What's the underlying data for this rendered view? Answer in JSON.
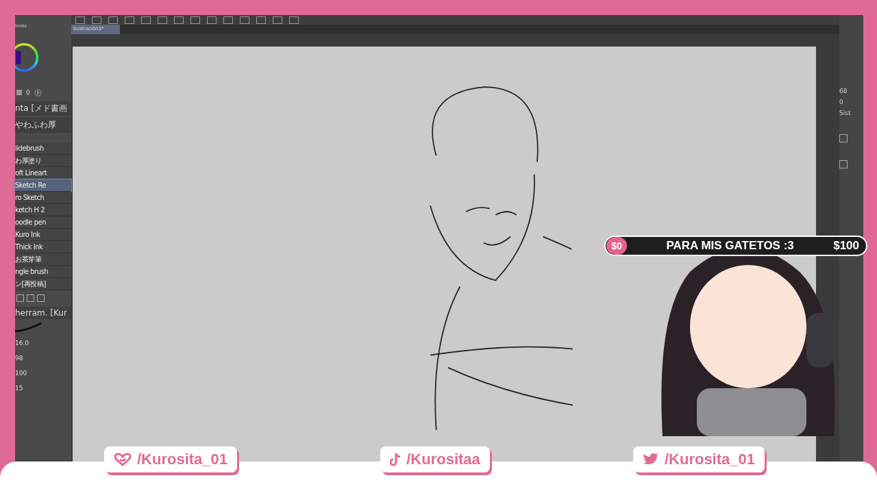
{
  "left_panel": {
    "header": "lores",
    "color_value": "0",
    "brush_set_label": "nta [メド書画",
    "brush_set_name": "やわふわ厚",
    "brushes": [
      {
        "name": "iidebrush",
        "selected": false
      },
      {
        "name": "わ厚塗り",
        "selected": false
      },
      {
        "name": "oft Lineart",
        "selected": false
      },
      {
        "name": "Sketch Re",
        "selected": true
      },
      {
        "name": "ro Sketch",
        "selected": false
      },
      {
        "name": "ketch H 2",
        "selected": false
      },
      {
        "name": "oodle pen",
        "selected": false
      },
      {
        "name": "Kuro Ink",
        "selected": false
      },
      {
        "name": "Thick Ink",
        "selected": false
      },
      {
        "name": "お茶芽筆",
        "selected": false
      },
      {
        "name": "ngle brush",
        "selected": false
      },
      {
        "name": "ン[再投稿]",
        "selected": false
      }
    ],
    "tool_property_label": "herram. [Kur",
    "values": [
      "16.0",
      "98",
      "100",
      "15"
    ]
  },
  "document_tab": {
    "title": "Ilustración3*"
  },
  "right_panel": {
    "values": [
      "68",
      "0"
    ],
    "label": "Sist"
  },
  "goal_bar": {
    "current": "$0",
    "title": "PARA MIS GATETOS :3",
    "target": "$100"
  },
  "socials": [
    {
      "kind": "heart",
      "handle": "/Kurosita_01"
    },
    {
      "kind": "tiktok",
      "handle": "/Kurositaa"
    },
    {
      "kind": "twitter",
      "handle": "/Kurosita_01"
    }
  ]
}
